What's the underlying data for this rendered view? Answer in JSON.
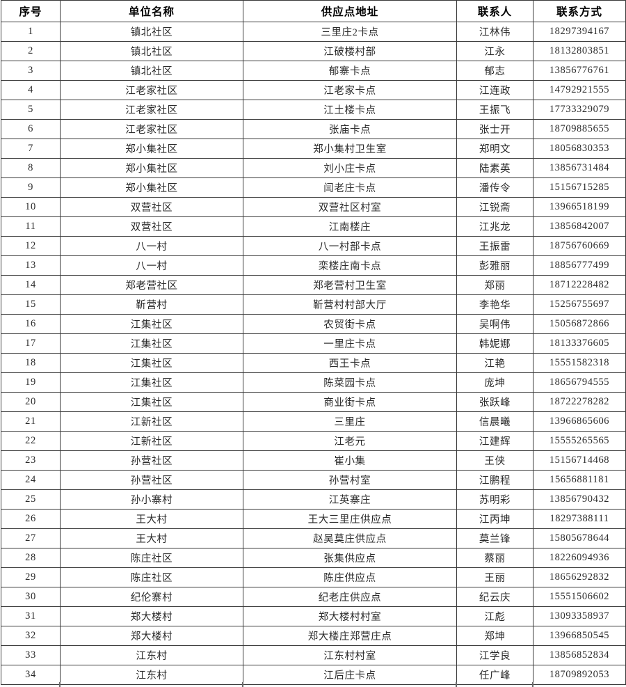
{
  "table": {
    "columns": [
      "序号",
      "单位名称",
      "供应点地址",
      "联系人",
      "联系方式"
    ],
    "rows": [
      [
        "1",
        "镇北社区",
        "三里庄2卡点",
        "江林伟",
        "18297394167"
      ],
      [
        "2",
        "镇北社区",
        "江破楼村部",
        "江永",
        "18132803851"
      ],
      [
        "3",
        "镇北社区",
        "郁寨卡点",
        "郁志",
        "13856776761"
      ],
      [
        "4",
        "江老家社区",
        "江老家卡点",
        "江连政",
        "14792921555"
      ],
      [
        "5",
        "江老家社区",
        "江土楼卡点",
        "王振飞",
        "17733329079"
      ],
      [
        "6",
        "江老家社区",
        "张庙卡点",
        "张士开",
        "18709885655"
      ],
      [
        "7",
        "郑小集社区",
        "郑小集村卫生室",
        "郑明文",
        "18056830353"
      ],
      [
        "8",
        "郑小集社区",
        "刘小庄卡点",
        "陆素英",
        "13856731484"
      ],
      [
        "9",
        "郑小集社区",
        "闫老庄卡点",
        "潘传令",
        "15156715285"
      ],
      [
        "10",
        "双营社区",
        "双营社区村室",
        "江锐斋",
        "13966518199"
      ],
      [
        "11",
        "双营社区",
        "江南楼庄",
        "江兆龙",
        "13856842007"
      ],
      [
        "12",
        "八一村",
        "八一村部卡点",
        "王振雷",
        "18756760669"
      ],
      [
        "13",
        "八一村",
        "栾楼庄南卡点",
        "彭雅丽",
        "18856777499"
      ],
      [
        "14",
        "郑老营社区",
        "郑老营村卫生室",
        "郑丽",
        "18712228482"
      ],
      [
        "15",
        "靳营村",
        "靳营村村部大厅",
        "李艳华",
        "15256755697"
      ],
      [
        "16",
        "江集社区",
        "农贸街卡点",
        "吴啊伟",
        "15056872866"
      ],
      [
        "17",
        "江集社区",
        "一里庄卡点",
        "韩妮娜",
        "18133376605"
      ],
      [
        "18",
        "江集社区",
        "西王卡点",
        "江艳",
        "15551582318"
      ],
      [
        "19",
        "江集社区",
        "陈菜园卡点",
        "庞坤",
        "18656794555"
      ],
      [
        "20",
        "江集社区",
        "商业街卡点",
        "张跃峰",
        "18722278282"
      ],
      [
        "21",
        "江新社区",
        "三里庄",
        "信晨曦",
        "13966865606"
      ],
      [
        "22",
        "江新社区",
        "江老元",
        "江建辉",
        "15555265565"
      ],
      [
        "23",
        "孙营社区",
        "崔小集",
        "王侠",
        "15156714468"
      ],
      [
        "24",
        "孙营社区",
        "孙营村室",
        "江鹏程",
        "15656881181"
      ],
      [
        "25",
        "孙小寨村",
        "江英寨庄",
        "苏明彩",
        "13856790432"
      ],
      [
        "26",
        "王大村",
        "王大三里庄供应点",
        "江丙坤",
        "18297388111"
      ],
      [
        "27",
        "王大村",
        "赵吴莫庄供应点",
        "莫兰锋",
        "15805678644"
      ],
      [
        "28",
        "陈庄社区",
        "张集供应点",
        "蔡丽",
        "18226094936"
      ],
      [
        "29",
        "陈庄社区",
        "陈庄供应点",
        "王丽",
        "18656292832"
      ],
      [
        "30",
        "纪伦寨村",
        "纪老庄供应点",
        "纪云庆",
        "15551506602"
      ],
      [
        "31",
        "郑大楼村",
        "郑大楼村村室",
        "江彪",
        "13093358937"
      ],
      [
        "32",
        "郑大楼村",
        "郑大楼庄郑营庄点",
        "郑坤",
        "13966850545"
      ],
      [
        "33",
        "江东村",
        "江东村村室",
        "江学良",
        "13856852834"
      ],
      [
        "34",
        "江东村",
        "江后庄卡点",
        "任广峰",
        "18709892053"
      ]
    ]
  },
  "colors": {
    "border": "#3a3a3a",
    "text": "#2b2b2b",
    "header_text": "#000000",
    "background": "#ffffff"
  }
}
